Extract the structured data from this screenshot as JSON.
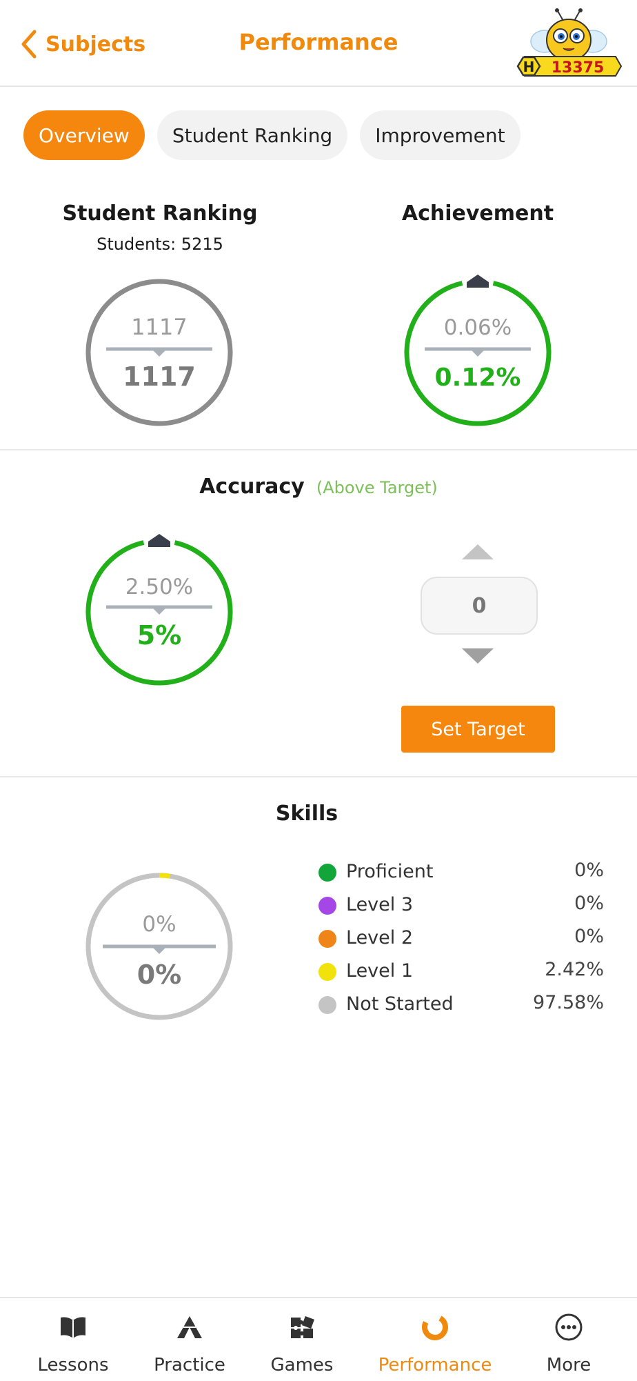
{
  "header": {
    "back_label": "Subjects",
    "title": "Performance",
    "coins_badge": "H",
    "coins": "13375"
  },
  "tabs": [
    {
      "label": "Overview",
      "active": true
    },
    {
      "label": "Student Ranking",
      "active": false
    },
    {
      "label": "Improvement",
      "active": false
    }
  ],
  "student_ranking": {
    "title": "Student Ranking",
    "students": "Students: 5215",
    "previous": "1117",
    "current": "1117"
  },
  "achievement": {
    "title": "Achievement",
    "previous": "0.06%",
    "current": "0.12%",
    "trend": "up"
  },
  "accuracy": {
    "title": "Accuracy",
    "status": "(Above Target)",
    "previous": "2.50%",
    "current": "5%",
    "trend": "up",
    "target_value": "0",
    "set_target_label": "Set Target"
  },
  "skills": {
    "title": "Skills",
    "previous": "0%",
    "current": "0%",
    "legend": [
      {
        "label": "Proficient",
        "value": "0%",
        "color": "#12a63a"
      },
      {
        "label": "Level 3",
        "value": "0%",
        "color": "#a546e6"
      },
      {
        "label": "Level 2",
        "value": "0%",
        "color": "#ef8418"
      },
      {
        "label": "Level 1",
        "value": "2.42%",
        "color": "#f2e20c"
      },
      {
        "label": "Not Started",
        "value": "97.58%",
        "color": "#c4c4c4"
      }
    ]
  },
  "colors": {
    "accent": "#f5870f",
    "positive": "#22b01a",
    "status_text": "#7cc05a",
    "neutral_ring": "#8c8c8c",
    "trend_marker": "#3a3d4a"
  },
  "bottom_nav": [
    {
      "label": "Lessons",
      "icon": "book-icon"
    },
    {
      "label": "Practice",
      "icon": "triangle-icon"
    },
    {
      "label": "Games",
      "icon": "puzzle-icon"
    },
    {
      "label": "Performance",
      "icon": "performance-ring-icon",
      "active": true
    },
    {
      "label": "More",
      "icon": "more-dots-icon"
    }
  ]
}
